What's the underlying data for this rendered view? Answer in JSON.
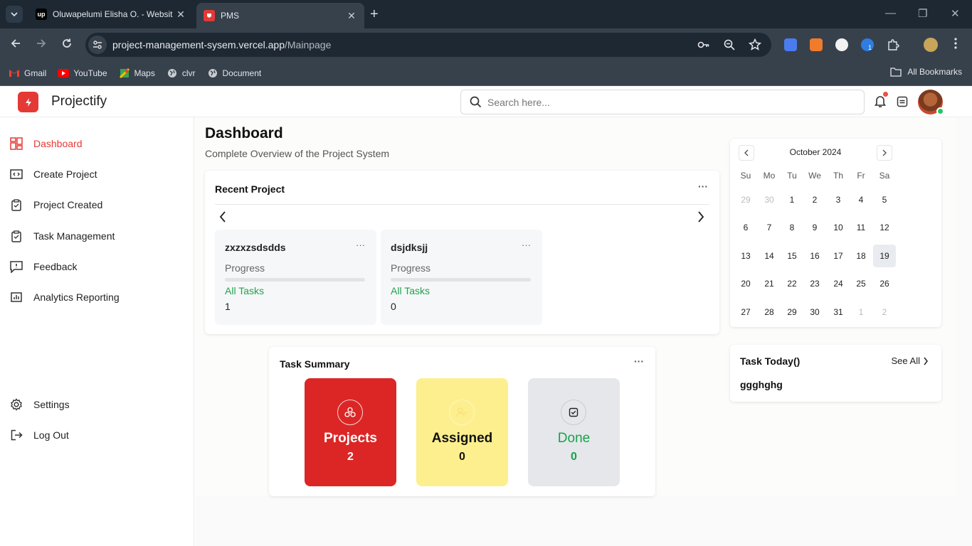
{
  "browser": {
    "tabs": [
      {
        "title": "Oluwapelumi Elisha O. - Websit",
        "favicon": "upwork-icon",
        "active": false
      },
      {
        "title": "PMS",
        "favicon": "pms-icon",
        "active": true
      }
    ],
    "url_host": "project-management-sysem.vercel.app",
    "url_path": "/Mainpage",
    "bookmarks": [
      "Gmail",
      "YouTube",
      "Maps",
      "clvr",
      "Document"
    ],
    "all_bookmarks": "All Bookmarks",
    "extension_badge": "1"
  },
  "app": {
    "name": "Projectify",
    "search_placeholder": "Search here...",
    "accent_color": "#e53935"
  },
  "sidebar": {
    "items": [
      {
        "label": "Dashboard",
        "icon": "dashboard-icon",
        "active": true
      },
      {
        "label": "Create Project",
        "icon": "create-project-icon"
      },
      {
        "label": "Project Created",
        "icon": "clipboard-icon"
      },
      {
        "label": "Task Management",
        "icon": "clipboard-check-icon"
      },
      {
        "label": "Feedback",
        "icon": "feedback-icon"
      },
      {
        "label": "Analytics Reporting",
        "icon": "analytics-icon"
      }
    ],
    "bottom": [
      {
        "label": "Settings",
        "icon": "gear-icon"
      },
      {
        "label": "Log Out",
        "icon": "logout-icon"
      }
    ]
  },
  "dashboard": {
    "title": "Dashboard",
    "subtitle": "Complete Overview of the Project System",
    "recent": {
      "title": "Recent Project",
      "projects": [
        {
          "name": "zxzxzsdsdds",
          "progress_label": "Progress",
          "progress": 0,
          "tasks_label": "All Tasks",
          "tasks_count": "1"
        },
        {
          "name": "dsjdksjj",
          "progress_label": "Progress",
          "progress": 0,
          "tasks_label": "All Tasks",
          "tasks_count": "0"
        }
      ]
    },
    "summary": {
      "title": "Task Summary",
      "boxes": [
        {
          "label": "Projects",
          "value": "2",
          "bg": "#dc2626",
          "fg": "#ffffff"
        },
        {
          "label": "Assigned",
          "value": "0",
          "bg": "#fdef8e",
          "fg": "#111111"
        },
        {
          "label": "Done",
          "value": "0",
          "bg": "#e5e7eb",
          "fg": "#16a34a"
        }
      ]
    },
    "calendar": {
      "month": "October 2024",
      "days_of_week": [
        "Su",
        "Mo",
        "Tu",
        "We",
        "Th",
        "Fr",
        "Sa"
      ],
      "weeks": [
        [
          "29",
          "30",
          "1",
          "2",
          "3",
          "4",
          "5"
        ],
        [
          "6",
          "7",
          "8",
          "9",
          "10",
          "11",
          "12"
        ],
        [
          "13",
          "14",
          "15",
          "16",
          "17",
          "18",
          "19"
        ],
        [
          "20",
          "21",
          "22",
          "23",
          "24",
          "25",
          "26"
        ],
        [
          "27",
          "28",
          "29",
          "30",
          "31",
          "1",
          "2"
        ]
      ],
      "today": "19"
    },
    "task_today": {
      "title": "Task Today()",
      "see_all": "See All",
      "items": [
        "ggghghg"
      ]
    }
  }
}
